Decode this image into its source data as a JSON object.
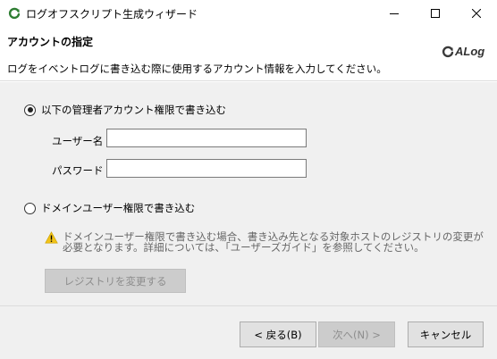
{
  "window": {
    "title": "ログオフスクリプト生成ウィザード"
  },
  "header": {
    "title": "アカウントの指定",
    "description": "ログをイベントログに書き込む際に使用するアカウント情報を入力してください。",
    "logo_text": "ALog"
  },
  "options": {
    "admin_label": "以下の管理者アカウント権限で書き込む",
    "admin_selected": true,
    "domain_label": "ドメインユーザー権限で書き込む",
    "domain_selected": false
  },
  "form": {
    "username_label": "ユーザー名",
    "username_value": "",
    "password_label": "パスワード",
    "password_value": ""
  },
  "warning": {
    "text": "ドメインユーザー権限で書き込む場合、書き込み先となる対象ホストのレジストリの変更が必要となります。詳細については、「ユーザーズガイド」を参照してください。"
  },
  "buttons": {
    "registry": "レジストリを変更する",
    "back": "< 戻る(B)",
    "next": "次へ(N) >",
    "cancel": "キャンセル"
  },
  "colors": {
    "icon_green": "#2e7d32",
    "warning_yellow": "#f2c318",
    "panel_bg": "#f0f0f0"
  }
}
